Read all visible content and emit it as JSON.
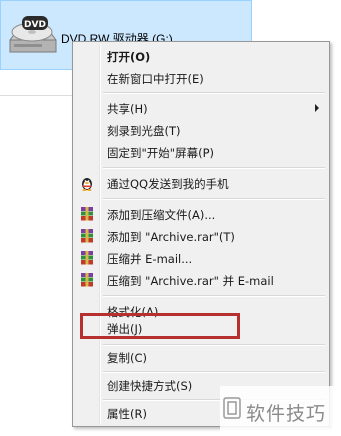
{
  "explorer": {
    "drive": {
      "label": "DVD RW 驱动器 (G:)",
      "icon": "dvd-drive-icon",
      "disc_text": "DVD"
    }
  },
  "context_menu": {
    "items": [
      {
        "label": "打开(O)",
        "bold": true
      },
      {
        "label": "在新窗口中打开(E)"
      },
      {
        "label": "共享(H)",
        "submenu": true
      },
      {
        "label": "刻录到光盘(T)"
      },
      {
        "label": "固定到\"开始\"屏幕(P)"
      },
      {
        "label": "通过QQ发送到我的手机",
        "icon": "qq-penguin-icon"
      },
      {
        "label": "添加到压缩文件(A)...",
        "icon": "winrar-icon"
      },
      {
        "label": "添加到 \"Archive.rar\"(T)",
        "icon": "winrar-icon"
      },
      {
        "label": "压缩并 E-mail...",
        "icon": "winrar-icon"
      },
      {
        "label": "压缩到 \"Archive.rar\" 并 E-mail",
        "icon": "winrar-icon"
      },
      {
        "label": "格式化(A)..."
      },
      {
        "label": "弹出(J)",
        "highlighted": true
      },
      {
        "label": "复制(C)"
      },
      {
        "label": "创建快捷方式(S)"
      },
      {
        "label": "属性(R)"
      }
    ],
    "highlight_color": "#b5302f"
  },
  "watermark": {
    "text": "软件技巧",
    "icon": "watermark-logo-icon"
  }
}
